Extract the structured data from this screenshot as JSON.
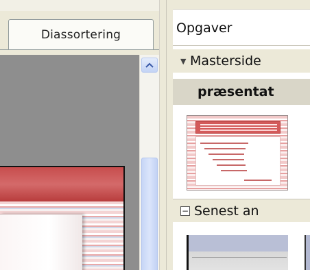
{
  "slide_panel": {
    "tab_label": "Diassortering",
    "scroll_position_fraction": 0.55
  },
  "task_pane": {
    "title": "Opgaver",
    "sections": {
      "master_pages": {
        "header": "Masterside",
        "collapse_icon": "triangle-down-icon",
        "subsection": "præsentat"
      },
      "recent": {
        "header": "Senest an",
        "collapse_icon": "minus-box-icon"
      }
    }
  },
  "colors": {
    "slide_red": "#c44a4a",
    "pane_background": "#ece9d8",
    "scroll_blue": "#c7d6f6"
  }
}
